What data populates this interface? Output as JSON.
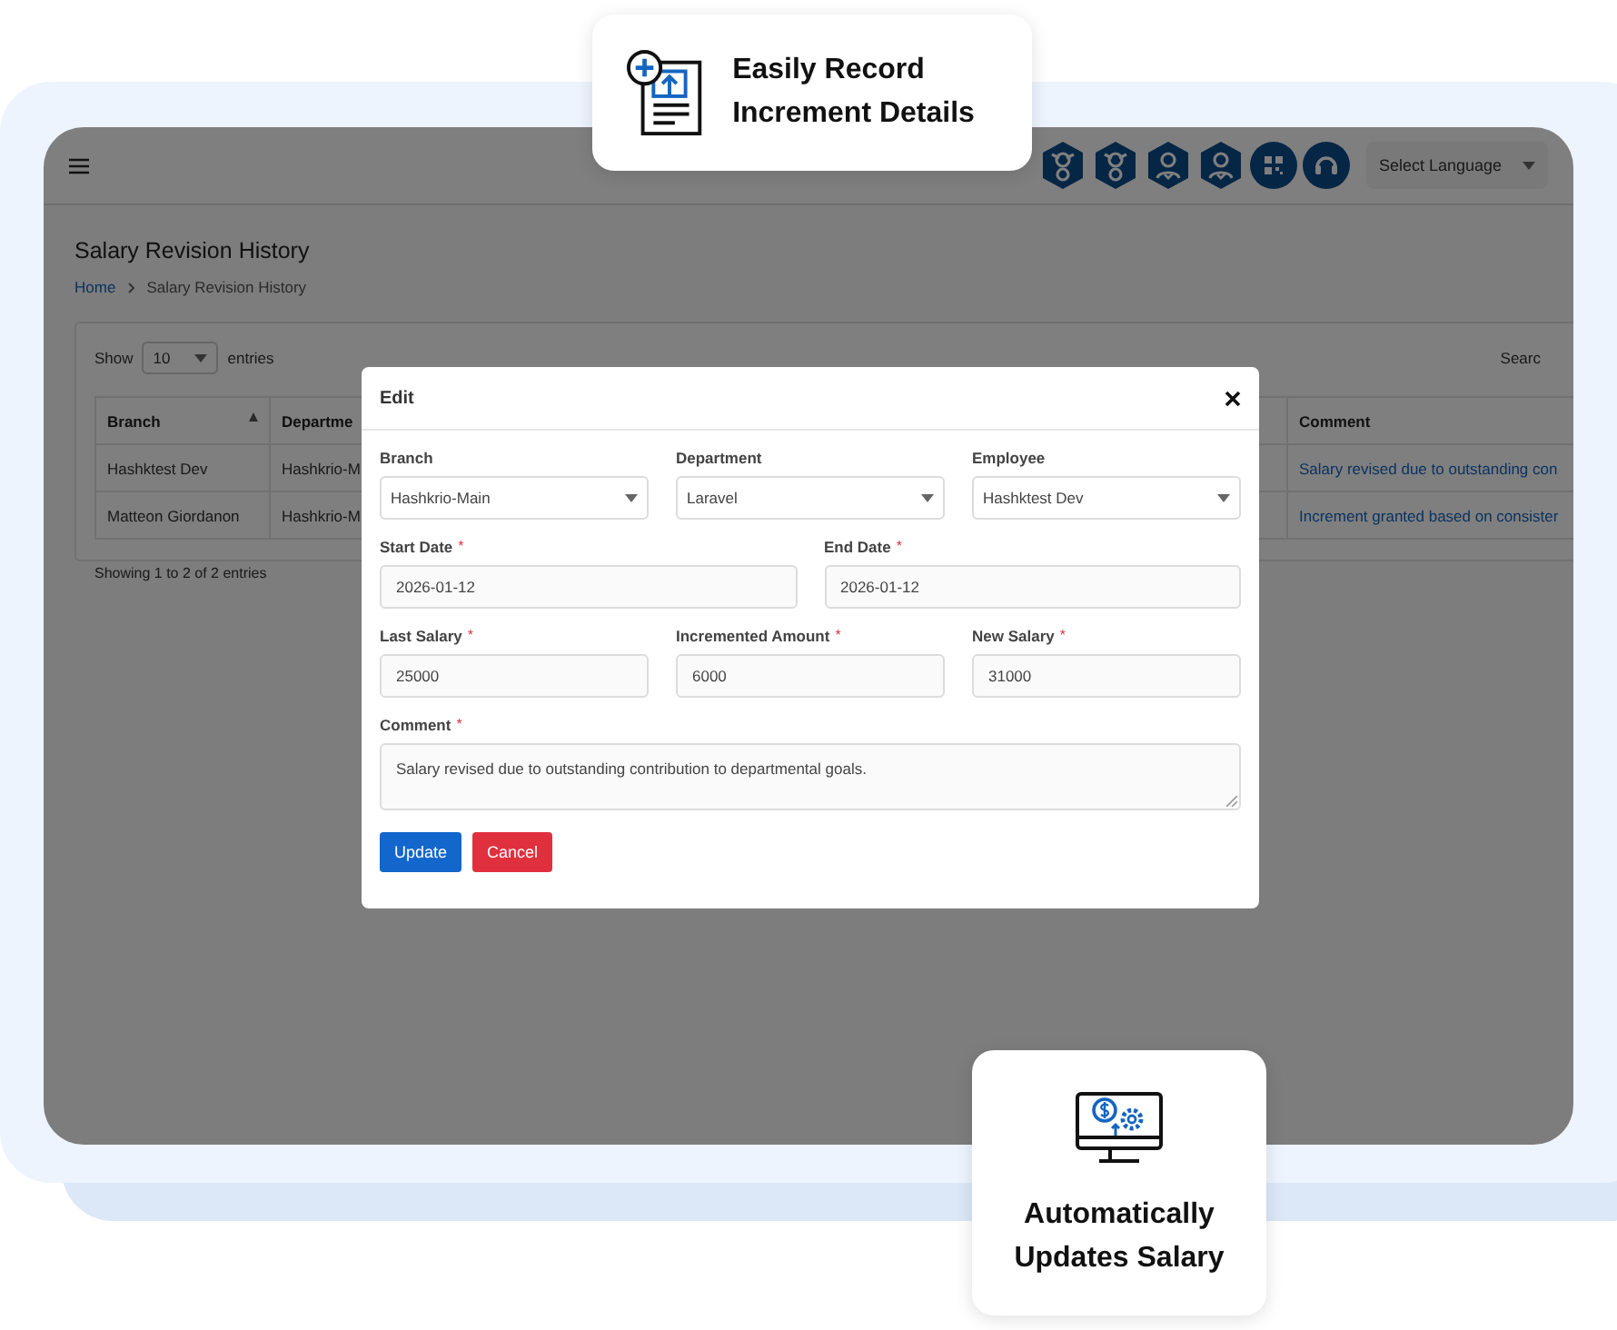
{
  "callouts": [
    {
      "kind": "record",
      "text": "Easily Record Increment Details"
    },
    {
      "kind": "salary",
      "text": "Automatically Updates Salary"
    }
  ],
  "top_bar": {
    "icons": [
      {
        "kind": "hex-link"
      },
      {
        "kind": "hex-link"
      },
      {
        "kind": "hex-user"
      },
      {
        "kind": "hex-user"
      },
      {
        "kind": "qr"
      },
      {
        "kind": "support"
      }
    ],
    "language_select": "Select Language"
  },
  "page": {
    "title": "Salary Revision History",
    "breadcrumb": [
      {
        "label": "Home",
        "link": true
      },
      {
        "label": "Salary Revision History",
        "link": false
      }
    ]
  },
  "table_controls": {
    "show_label": "Show",
    "page_size": "10",
    "entries_label": "entries",
    "search_label": "Searc"
  },
  "table": {
    "columns": [
      {
        "label": "Branch",
        "sorted": true
      },
      {
        "label": "Departme",
        "sorted": false
      },
      {
        "label": "Comment",
        "sorted": false
      }
    ],
    "rows": [
      [
        "Hashktest Dev",
        "Hashkrio-M",
        "Salary revised due to outstanding con"
      ],
      [
        "Matteon Giordanon",
        "Hashkrio-M",
        "Increment granted based on consister"
      ]
    ]
  },
  "table_info": "Showing 1 to 2 of 2 entries",
  "modal": {
    "title": "Edit",
    "rows": [
      [
        {
          "label": "Branch",
          "kind": "select",
          "value": "Hashkrio-Main"
        },
        {
          "label": "Department",
          "kind": "select",
          "value": "Laravel"
        },
        {
          "label": "Employee",
          "kind": "select",
          "value": "Hashktest Dev"
        }
      ],
      [
        {
          "label": "Start Date",
          "required_mark": "*",
          "kind": "text",
          "value": "2026-01-12"
        },
        {
          "label": "End Date",
          "required_mark": "*",
          "kind": "text",
          "value": "2026-01-12"
        }
      ],
      [
        {
          "label": "Last Salary",
          "required_mark": "*",
          "kind": "text",
          "value": "25000"
        },
        {
          "label": "Incremented Amount",
          "required_mark": "*",
          "kind": "text",
          "value": "6000"
        },
        {
          "label": "New Salary",
          "required_mark": "*",
          "kind": "text",
          "value": "31000"
        }
      ],
      [
        {
          "label": "Comment",
          "required_mark": "*",
          "kind": "textarea",
          "value": "Salary revised due to outstanding contribution to departmental goals."
        }
      ]
    ],
    "buttons": [
      {
        "label": "Update",
        "kind": "primary"
      },
      {
        "label": "Cancel",
        "kind": "danger"
      }
    ]
  }
}
